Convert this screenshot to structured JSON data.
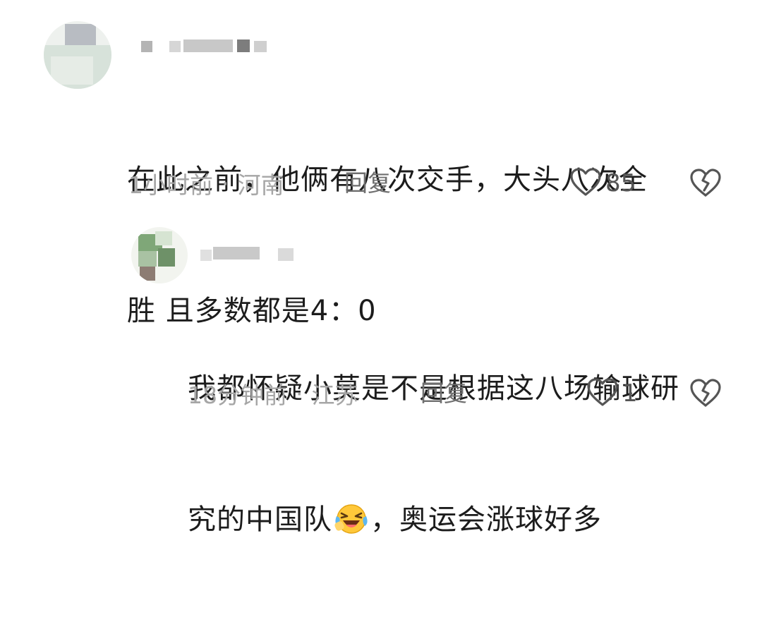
{
  "comments": [
    {
      "text": "在此之前，他俩有八次交手，大头八次全胜 且多数都是4：0",
      "line1": "在此之前，他俩有八次交手，大头八次全",
      "line2": "胜 且多数都是4：0",
      "time": "1小时前",
      "sep": "·",
      "location": "河南",
      "reply_label": "回复",
      "likes": "85",
      "like_icon": "heart-outline-icon",
      "dislike_icon": "broken-heart-icon"
    },
    {
      "line1": "我都怀疑小莫是不是根据这八场输球研",
      "line2_before": "究的中国队",
      "emoji": "laughing-tears-emoji",
      "line2_after": "，奥运会涨球好多",
      "time": "18分钟前",
      "sep": "·",
      "location": "江苏",
      "reply_label": "回复",
      "likes": "1",
      "like_icon": "heart-outline-icon",
      "dislike_icon": "broken-heart-icon"
    }
  ],
  "colors": {
    "text": "#1c1c1c",
    "meta": "#a6a6a6",
    "reply": "#6f6f6f",
    "icon": "#555555"
  }
}
